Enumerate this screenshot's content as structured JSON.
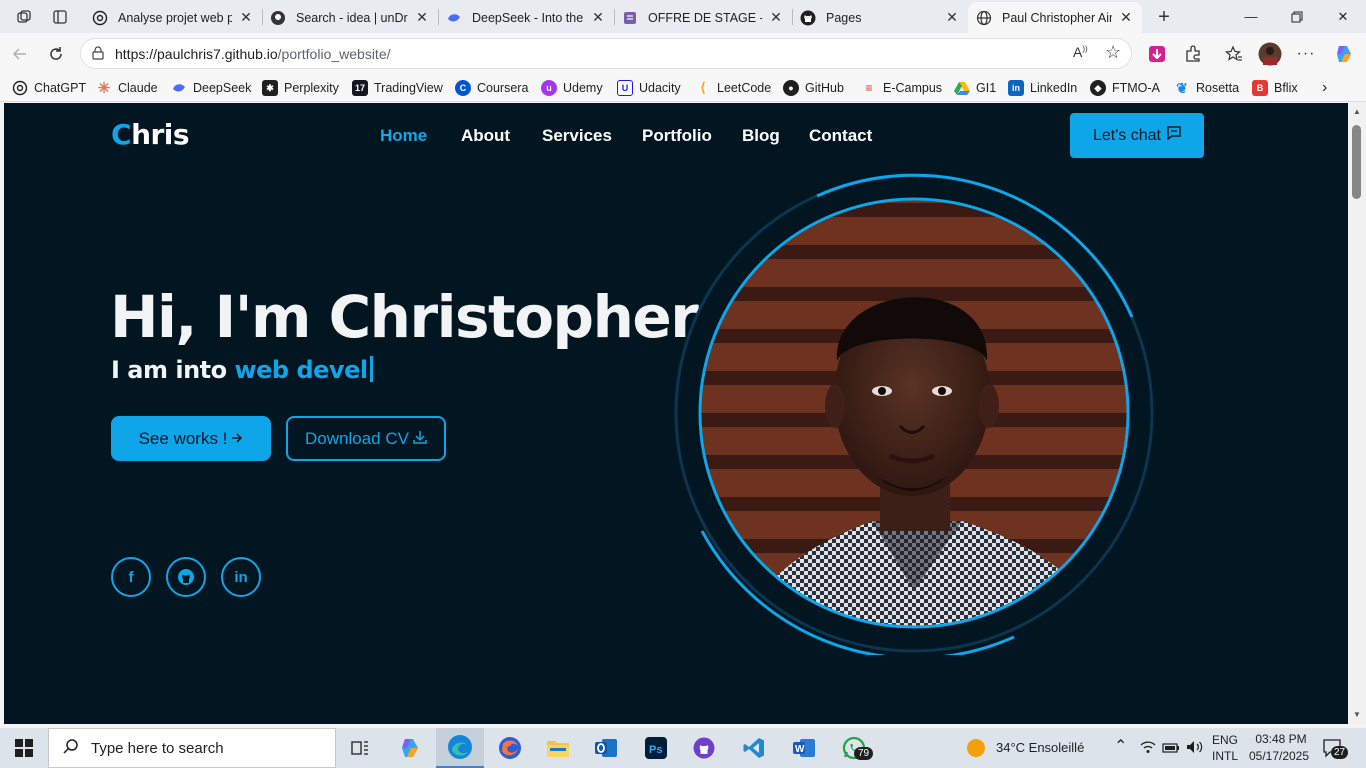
{
  "browser": {
    "tabs": [
      {
        "title": "Analyse projet web pe",
        "icon": "chatgpt-icon"
      },
      {
        "title": "Search - idea | unDraw",
        "icon": "undraw-icon"
      },
      {
        "title": "DeepSeek - Into the U",
        "icon": "deepseek-icon"
      },
      {
        "title": "OFFRE DE STAGE - CA",
        "icon": "forms-icon"
      },
      {
        "title": "Pages",
        "icon": "github-icon"
      },
      {
        "title": "Paul Christopher Aime",
        "icon": "globe-icon"
      }
    ],
    "url_host": "https://paulchris7.github.io",
    "url_path": "/portfolio_website/",
    "bookmarks": [
      "ChatGPT",
      "Claude",
      "DeepSeek",
      "Perplexity",
      "TradingView",
      "Coursera",
      "Udemy",
      "Udacity",
      "LeetCode",
      "GitHub",
      "E-Campus",
      "GI1",
      "LinkedIn",
      "FTMO-A",
      "Rosetta",
      "Bflix"
    ]
  },
  "site": {
    "logo_first": "C",
    "logo_rest": "hris",
    "nav": [
      "Home",
      "About",
      "Services",
      "Portfolio",
      "Blog",
      "Contact"
    ],
    "active_nav": "Home",
    "chat_button": "Let's chat",
    "hero_title": "Hi, I'm Christopher",
    "hero_sub_prefix": "I am into ",
    "hero_sub_typed": "web devel",
    "see_works": "See works !",
    "download_cv": "Download CV",
    "socials": [
      "facebook-icon",
      "github-icon",
      "linkedin-icon"
    ],
    "accent": "#0ea5e9",
    "background": "#021621"
  },
  "taskbar": {
    "search_placeholder": "Type here to search",
    "whatsapp_badge": "79",
    "weather": "34°C  Ensoleillé",
    "lang_1": "ENG",
    "lang_2": "INTL",
    "time": "03:48 PM",
    "date": "05/17/2025",
    "notifications": "27"
  }
}
